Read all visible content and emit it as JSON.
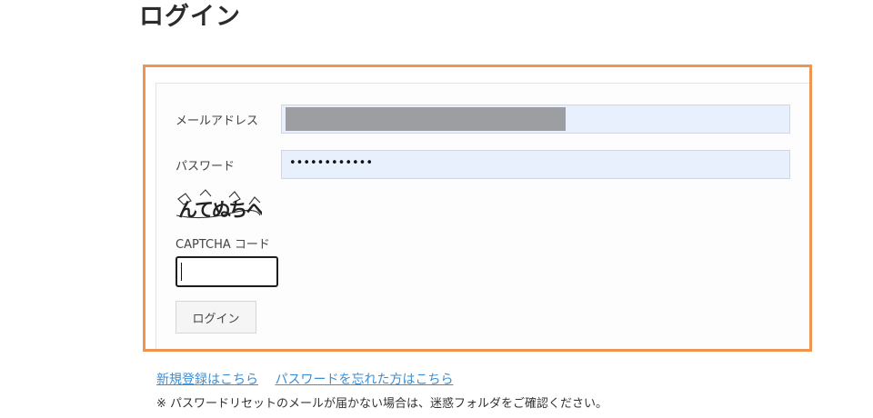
{
  "page": {
    "title": "ログイン"
  },
  "form": {
    "email_label": "メールアドレス",
    "password_label": "パスワード",
    "password_masked": "••••••••••••",
    "captcha_image_text": "んてぬちへ",
    "captcha_label": "CAPTCHA コード",
    "submit_label": "ログイン"
  },
  "links": {
    "register": "新規登録はこちら",
    "forgot_password": "パスワードを忘れた方はこちら"
  },
  "notice": "※ パスワードリセットのメールが届かない場合は、迷惑フォルダをご確認ください。",
  "colors": {
    "highlight_frame": "#ef9551",
    "autofill_bg": "#e8f0fe",
    "link": "#3a8fd6",
    "redaction": "#9c9ea2"
  }
}
